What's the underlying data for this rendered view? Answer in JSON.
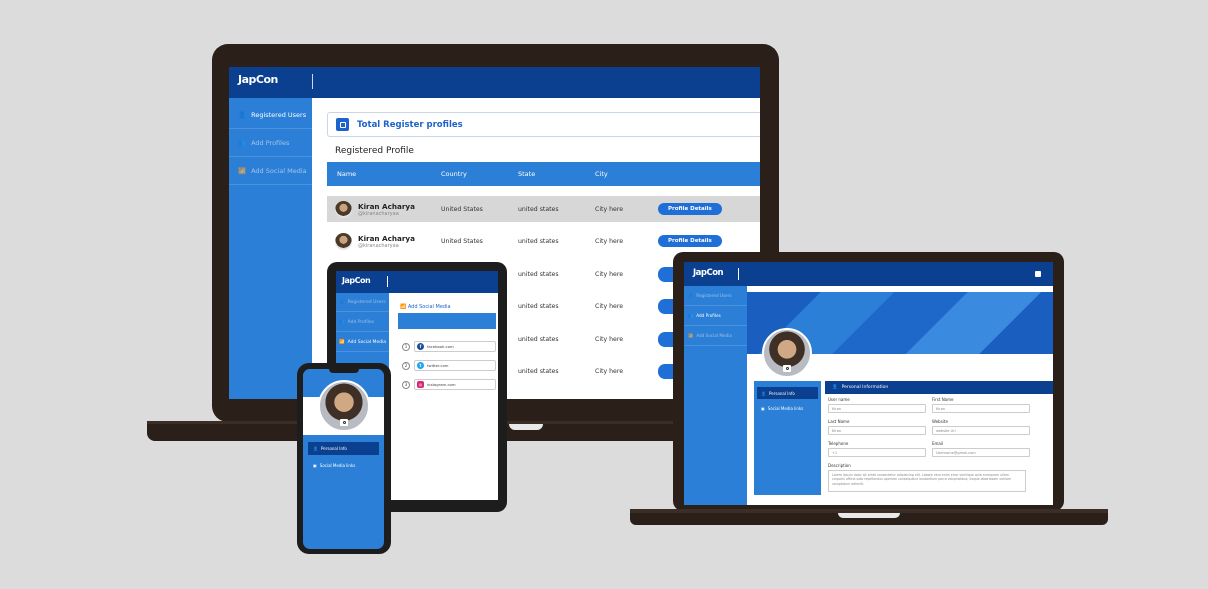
{
  "brand": {
    "logo": "JapCon",
    "tagline": "",
    "accent": "#2b7fd6",
    "dark": "#0b3f8f"
  },
  "desktop": {
    "nav": [
      {
        "label": "Registered Users",
        "icon": "user-icon"
      },
      {
        "label": "Add Profiles",
        "icon": "add-users-icon"
      },
      {
        "label": "Add Social Media",
        "icon": "wifi-icon"
      }
    ],
    "total_title": "Total Register profiles",
    "section_title": "Registered Profile",
    "columns": [
      "Name",
      "Country",
      "State",
      "City"
    ],
    "rows": [
      {
        "name": "Kiran Acharya",
        "handle": "@kiranacharyaa",
        "country": "United States",
        "state": "united states",
        "city": "City here",
        "action": "Profile Details"
      },
      {
        "name": "Kiran Acharya",
        "handle": "@kiranacharyaa",
        "country": "United States",
        "state": "united states",
        "city": "City here",
        "action": "Profile Details"
      },
      {
        "state": "united states",
        "city": "City here"
      },
      {
        "state": "united states",
        "city": "City here"
      },
      {
        "state": "united states",
        "city": "City here"
      },
      {
        "state": "united states",
        "city": "City here"
      }
    ]
  },
  "tablet": {
    "nav": [
      "Registered Users",
      "Add Profiles",
      "Add Social Media"
    ],
    "title": "Add Social Media",
    "links": [
      {
        "num": "1",
        "text": "facebook.com",
        "icon": "facebook-icon",
        "color": "#1b4e9b"
      },
      {
        "num": "2",
        "text": "twitter.com",
        "icon": "twitter-icon",
        "color": "#1da1f2"
      },
      {
        "num": "3",
        "text": "instagram.com",
        "icon": "instagram-icon",
        "color": "#d62976"
      }
    ]
  },
  "phone": {
    "nav": [
      "Personal Info",
      "Social Media links"
    ]
  },
  "laptop": {
    "nav": [
      "Registered Users",
      "Add Profiles",
      "Add Social Media"
    ],
    "left_nav": [
      "Personal Info",
      "Social Media links"
    ],
    "form_title": "Personal Information",
    "fields": {
      "user_name": {
        "label": "User name",
        "value": "Kiran"
      },
      "first_name": {
        "label": "First Name",
        "value": "Kiran"
      },
      "last_name": {
        "label": "Last Name",
        "value": "Kiran"
      },
      "website": {
        "label": "Website",
        "value": "website Url"
      },
      "telephone": {
        "label": "Telephone",
        "value": "+1"
      },
      "email": {
        "label": "Email",
        "value": "Username@gmail.com"
      },
      "description": {
        "label": "Description",
        "value": "Lorem ipsum dolor sit amet consectetur adipisicing elit. Labore vero enim error similique quia numquam ullam corporis officia odio repellendus aperiam consequatur laudantium porro voluptatibus, itaque laboriosam veniam voluptatum deleniti."
      }
    }
  }
}
